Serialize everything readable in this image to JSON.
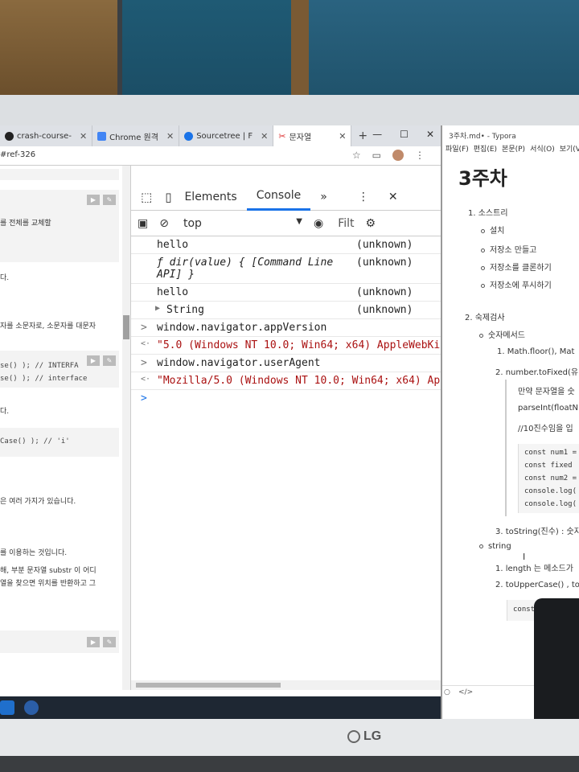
{
  "browser": {
    "tabs": [
      {
        "label": "crash-course-",
        "icon": "github-icon"
      },
      {
        "label": "Chrome 원격",
        "icon": "chrome-icon"
      },
      {
        "label": "Sourcetree | F",
        "icon": "map-pin-icon"
      },
      {
        "label": "문자열",
        "icon": "scissors-icon",
        "active": true
      }
    ],
    "new_tab": "+",
    "address_fragment": "#ref-326",
    "win_min": "—",
    "win_max": "☐",
    "win_close": "✕"
  },
  "page": {
    "line1": "를 전체를 교체할",
    "line2": "다.",
    "line3": "자를 소문자로, 소문자를 대문자",
    "code1": "se() ); // INTERFA",
    "code2": "se() ); // interface",
    "line4": "다.",
    "code3": "Case() ); // 'i'",
    "line5": "은 여러 가지가 있습니다.",
    "line6": "를 이용하는 것입니다.",
    "line7": "해, 부분 문자열 substr 이 어디",
    "line8": "열을 찾으면 위치를 반환하고 그"
  },
  "devtools": {
    "tabs": [
      "Elements",
      "Console"
    ],
    "more": "»",
    "context": "top",
    "filter": "Filt",
    "rows": [
      {
        "prefix": "",
        "text": "hello",
        "src": "(unknown)"
      },
      {
        "prefix": "",
        "text": "ƒ dir(value) { [Command Line",
        "text2": "API] }",
        "src": "(unknown)"
      },
      {
        "prefix": "",
        "text": "hello",
        "src": "(unknown)"
      },
      {
        "prefix": "▶",
        "text": "String",
        "src": "(unknown)"
      },
      {
        "prefix": ">",
        "text": "window.navigator.appVersion",
        "src": ""
      },
      {
        "prefix": "<·",
        "text": "\"5.0 (Windows NT 10.0; Win64; x64) AppleWebKi",
        "src": ""
      },
      {
        "prefix": ">",
        "text": "window.navigator.userAgent",
        "src": ""
      },
      {
        "prefix": "<·",
        "text": "\"Mozilla/5.0 (Windows NT 10.0; Win64; x64) Ap",
        "src": ""
      },
      {
        "prefix": ">",
        "text": "",
        "src": ""
      }
    ]
  },
  "typora": {
    "window_title": "3주차.md• - Typora",
    "menu": [
      "파일(F)",
      "편집(E)",
      "본문(P)",
      "서식(O)",
      "보기(V"
    ],
    "heading": "3주차",
    "items": {
      "i1": "1. 소스트리",
      "i1a": "설치",
      "i1b": "저장소 만들고",
      "i1c": "저장소를 클론하기",
      "i1d": "저장소에 푸시하기",
      "i2": "2. 숙제검사",
      "i2a": "숫자메서드",
      "i2a1": "1. Math.floor(),  Mat",
      "i2a2": "2. number.toFixed(유",
      "p1": "만약 문자열을 숫",
      "p2": "parseInt(floatN",
      "p3": "//10진수임을 입",
      "c1": "const num1 =",
      "c2": "const fixed",
      "c3": "const num2 =",
      "c4": "console.log(",
      "c5": "console.log(",
      "i2a3": "3. toString(진수) : 숫자",
      "i2b": "string",
      "i2b1": "1. length 는 메소드가",
      "i2b2": "2. toUpperCase() , to",
      "c6": "const"
    },
    "footer_left": "○",
    "footer_code": "</>"
  },
  "monitor": {
    "brand": "LG"
  }
}
